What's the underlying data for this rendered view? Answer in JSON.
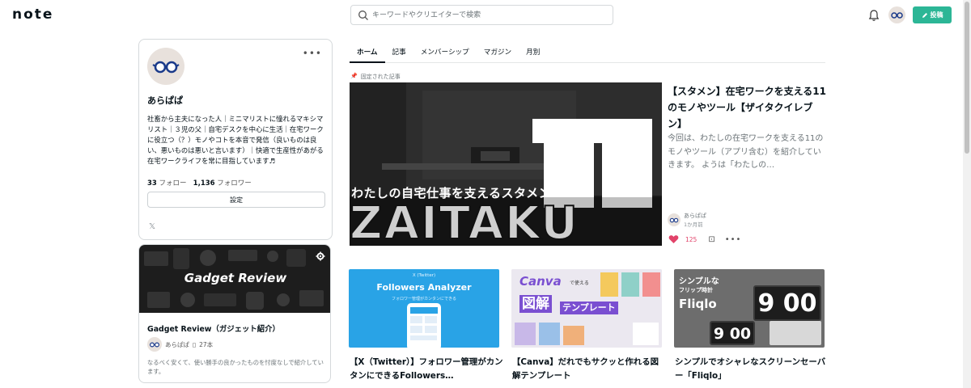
{
  "header": {
    "logo": "note",
    "search_placeholder": "キーワードやクリエイターで検索",
    "post_label": "投稿"
  },
  "profile": {
    "name": "あらぱぱ",
    "bio": "社畜から主夫になった人｜ミニマリストに憧れるマキシマリスト｜３児の父｜自宅デスクを中心に生活｜在宅ワークに役立つ（？）モノやコトを本音で発信（良いものは良い、悪いものは悪いと言います）｜快適で生産性があがる在宅ワークライフを常に目指しています♬",
    "follow_count": "33",
    "follow_label": "フォロー",
    "follower_count": "1,136",
    "follower_label": "フォロワー",
    "settings_label": "設定",
    "more_icon": "more-horizontal-icon",
    "x_icon": "x-logo-icon"
  },
  "magazine": {
    "banner_title": "Gadget Review",
    "title": "Gadget Review（ガジェット紹介）",
    "author": "あらぱぱ",
    "article_count": "27本",
    "description": "なるべく安くて、使い勝手の良かったものを忖度なしで紹介しています。"
  },
  "tabs": [
    "ホーム",
    "記事",
    "メンバーシップ",
    "マガジン",
    "月別"
  ],
  "pinned_label": "固定された記事",
  "featured": {
    "title": "【スタメン】在宅ワークを支える11のモノやツール【ザイタクイレブン】",
    "excerpt": "今回は、わたしの在宅ワークを支える11のモノやツール（アプリ含む）を紹介していきます。 ようは「わたしの…",
    "author": "あらぱぱ",
    "time": "1か月前",
    "likes": "125",
    "image_number": "11",
    "image_caption": "わたしの自宅仕事を支えるスタメン",
    "image_word": "ZAITAKU"
  },
  "cards": [
    {
      "title": "【X（Twitter）】フォロワー管理がカンタンにできるFollowers…",
      "img_small": "X (Twitter)",
      "img_title": "Followers Analyzer",
      "img_sub": "フォロワー管理がカンタンにできる"
    },
    {
      "title": "【Canva】だれでもサクッと作れる図解テンプレート",
      "img_brand": "Canva",
      "img_small": "で使える",
      "img_title": "図解",
      "img_sub": "テンプレート"
    },
    {
      "title": "シンプルでオシャレなスクリーンセーバー「Fliqlo」",
      "img_line1": "シンプルな",
      "img_line2": "フリップ時計",
      "img_title": "Fliqlo",
      "clock_top": "9 00",
      "clock_bottom": "9 00"
    }
  ],
  "colors": {
    "accent": "#2cb696",
    "like": "#e2436a",
    "card1_bg": "#29a3e6",
    "card3_bg": "#6d6d6d"
  }
}
